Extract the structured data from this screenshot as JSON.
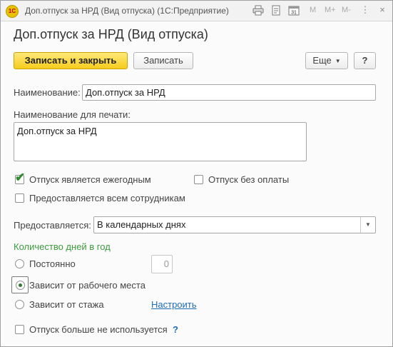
{
  "window": {
    "title": "Доп.отпуск за НРД (Вид отпуска)  (1С:Предприятие)",
    "logo": "1С",
    "toolbar_icons": [
      "printer-icon",
      "document-icon",
      "calendar-icon"
    ],
    "calendar_day": "31",
    "memory_buttons": [
      "M",
      "M+",
      "M-"
    ]
  },
  "form": {
    "title": "Доп.отпуск за НРД (Вид отпуска)",
    "buttons": {
      "save_close": "Записать и закрыть",
      "save": "Записать",
      "more": "Еще",
      "help": "?"
    },
    "name": {
      "label": "Наименование:",
      "value": "Доп.отпуск за НРД"
    },
    "print_name": {
      "label": "Наименование для печати:",
      "value": "Доп.отпуск за НРД"
    },
    "checkboxes": {
      "annual": {
        "label": "Отпуск является ежегодным",
        "checked": true
      },
      "unpaid": {
        "label": "Отпуск без оплаты",
        "checked": false
      },
      "all_employees": {
        "label": "Предоставляется всем сотрудникам",
        "checked": false
      },
      "not_used": {
        "label": "Отпуск больше не используется",
        "checked": false
      }
    },
    "provided": {
      "label": "Предоставляется:",
      "value": "В календарных днях"
    },
    "days_section": {
      "title": "Количество дней в год",
      "options": {
        "constant": "Постоянно",
        "workplace": "Зависит от рабочего места",
        "seniority": "Зависит от стажа"
      },
      "selected": "workplace",
      "days_value": "0",
      "configure_link": "Настроить"
    },
    "help_mark": "?"
  },
  "colors": {
    "primary_button": "#f6cc1c",
    "section_title": "#3c9a3c",
    "link": "#1f6db5",
    "checkmark": "#2e8b2e"
  }
}
